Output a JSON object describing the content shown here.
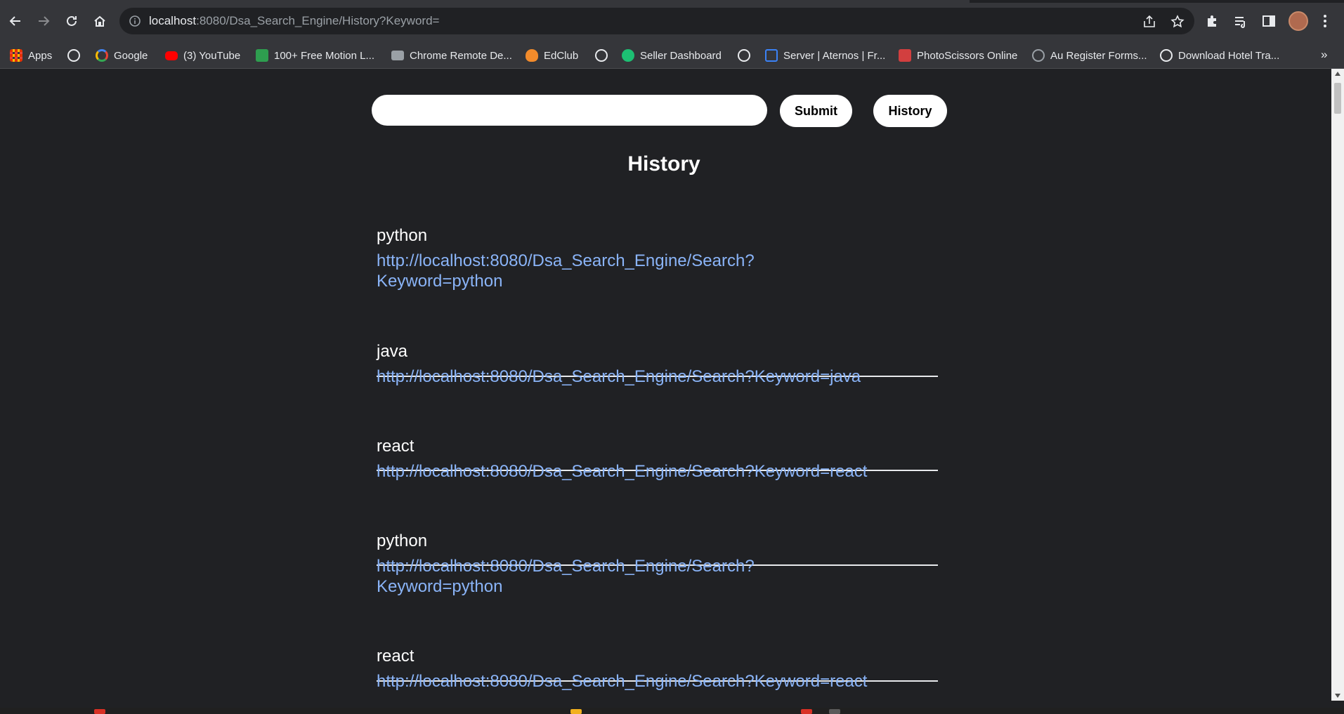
{
  "browser": {
    "url_host": "localhost",
    "url_rest": ":8080/Dsa_Search_Engine/History?Keyword="
  },
  "bookmarks": [
    {
      "label": "Apps",
      "icon": "apps-grid-icon",
      "color": "#ea4335"
    },
    {
      "label": "",
      "icon": "globe-icon",
      "color": "#e8eaed"
    },
    {
      "label": "Google",
      "icon": "google-icon",
      "color": "#4285f4"
    },
    {
      "label": "(3) YouTube",
      "icon": "youtube-icon",
      "color": "#ff0000"
    },
    {
      "label": "100+ Free Motion L...",
      "icon": "px-icon",
      "color": "#2e9e4f"
    },
    {
      "label": "Chrome Remote De...",
      "icon": "remote-desktop-icon",
      "color": "#9aa0a6"
    },
    {
      "label": "EdClub",
      "icon": "edclub-icon",
      "color": "#f28b2b"
    },
    {
      "label": "",
      "icon": "globe-icon",
      "color": "#e8eaed"
    },
    {
      "label": "Seller Dashboard",
      "icon": "fiverr-icon",
      "color": "#1dbf73"
    },
    {
      "label": "",
      "icon": "globe-icon",
      "color": "#e8eaed"
    },
    {
      "label": "Server | Aternos | Fr...",
      "icon": "aternos-icon",
      "color": "#3b82f6"
    },
    {
      "label": "PhotoScissors Online",
      "icon": "photoscissors-icon",
      "color": "#d23f3f"
    },
    {
      "label": "Au Register Forms...",
      "icon": "wordpress-icon",
      "color": "#9aa0a6"
    },
    {
      "label": "Download Hotel Tra...",
      "icon": "globe-icon",
      "color": "#e8eaed"
    }
  ],
  "search": {
    "placeholder": "",
    "submit_label": "Submit",
    "history_label": "History"
  },
  "heading": "History",
  "history": [
    {
      "keyword": "python",
      "url": "http://localhost:8080/Dsa_Search_Engine/Search?Keyword=python"
    },
    {
      "keyword": "java",
      "url": "http://localhost:8080/Dsa_Search_Engine/Search?Keyword=java"
    },
    {
      "keyword": "react",
      "url": "http://localhost:8080/Dsa_Search_Engine/Search?Keyword=react"
    },
    {
      "keyword": "python",
      "url": "http://localhost:8080/Dsa_Search_Engine/Search?Keyword=python"
    },
    {
      "keyword": "react",
      "url": "http://localhost:8080/Dsa_Search_Engine/Search?Keyword=react"
    }
  ]
}
